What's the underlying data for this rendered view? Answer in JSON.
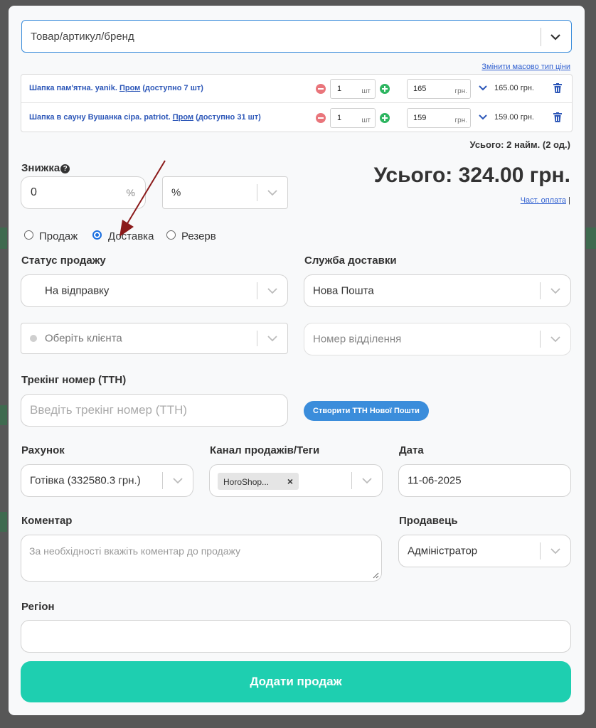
{
  "product_search": {
    "placeholder": "Товар/артикул/бренд"
  },
  "mass_price_link": "Змінити масово тип ціни",
  "products": [
    {
      "name": "Шапка пам'ятна. yanik.",
      "source": "Пром",
      "available": "(доступно 7 шт)",
      "qty": "1",
      "qty_unit": "шт",
      "price": "165",
      "price_unit": "грн.",
      "total": "165.00 грн."
    },
    {
      "name": "Шапка в сауну Вушанка сіра. patriot.",
      "source": "Пром",
      "available": "(доступно 31 шт)",
      "qty": "1",
      "qty_unit": "шт",
      "price": "159",
      "price_unit": "грн.",
      "total": "159.00 грн."
    }
  ],
  "items_summary": "Усього: 2 найм. (2 од.)",
  "discount": {
    "label": "Знижка",
    "value": "0",
    "unit": "%",
    "type": "%"
  },
  "grand_total": "Усього: 324.00 грн.",
  "partial_payment_link": "Част. оплата",
  "partial_separator": "|",
  "sale_types": [
    {
      "label": "Продаж",
      "checked": false
    },
    {
      "label": "Доставка",
      "checked": true
    },
    {
      "label": "Резерв",
      "checked": false
    }
  ],
  "sale_status": {
    "label": "Статус продажу",
    "value": "На відправку"
  },
  "delivery_service": {
    "label": "Служба доставки",
    "value": "Нова Пошта"
  },
  "client": {
    "placeholder": "Оберіть клієнта"
  },
  "branch": {
    "placeholder": "Номер відділення"
  },
  "tracking": {
    "label": "Трекінг номер (ТТН)",
    "placeholder": "Введіть трекінг номер (ТТН)",
    "button": "Створити ТТН Нової Пошти"
  },
  "account": {
    "label": "Рахунок",
    "value": "Готівка (332580.3 грн.)"
  },
  "channel": {
    "label": "Канал продажів/Теги",
    "tag": "HoroShop...",
    "tag_remove": "×"
  },
  "date": {
    "label": "Дата",
    "value": "11-06-2025"
  },
  "comment": {
    "label": "Коментар",
    "placeholder": "За необхідності вкажіть коментар до продажу"
  },
  "seller": {
    "label": "Продавець",
    "value": "Адміністратор"
  },
  "region": {
    "label": "Регіон",
    "value": ""
  },
  "submit_label": "Додати продаж",
  "colors": {
    "accent": "#3b8ddb",
    "submit": "#1ecfb0",
    "link": "#2f5fd0",
    "annotation_arrow": "#8b1a1a"
  }
}
